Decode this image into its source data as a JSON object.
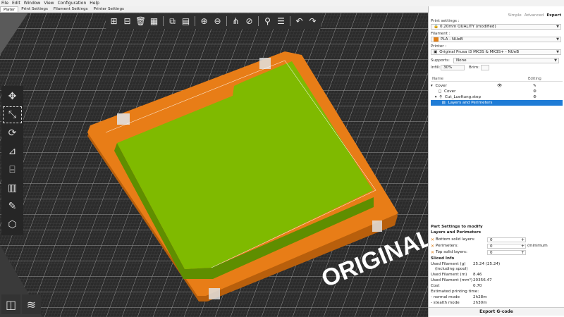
{
  "menu": [
    "File",
    "Edit",
    "Window",
    "View",
    "Configuration",
    "Help"
  ],
  "tabs": [
    {
      "label": "Plater",
      "active": true
    },
    {
      "label": "Print Settings",
      "active": false
    },
    {
      "label": "Filament Settings",
      "active": false
    },
    {
      "label": "Printer Settings",
      "active": false
    }
  ],
  "viewport": {
    "watermark": "ORIGINAL PR",
    "colors": {
      "bed": "#2b2b2b",
      "grid": "#9c9c9c",
      "base": "#e87d17",
      "top": "#7fba00",
      "topSide": "#5f8e00"
    }
  },
  "toolbar_icons": [
    "add-icon",
    "delete-icon",
    "delete-all-icon",
    "arrange-icon",
    "copy-icon",
    "paste-icon",
    "add-instance-icon",
    "remove-instance-icon",
    "split-objects-icon",
    "split-parts-icon",
    "search-icon",
    "layers-icon",
    "undo-icon",
    "redo-icon"
  ],
  "mode": {
    "simple": "Simple",
    "advanced": "Advanced",
    "expert": "Expert"
  },
  "print_settings": {
    "label": "Print settings :",
    "value": "0.20mm QUALITY (modified)"
  },
  "filament": {
    "label": "Filament :",
    "value": "PLA - NUeB",
    "color": "#e07f18"
  },
  "printer": {
    "label": "Printer :",
    "value": "Original Prusa i3 MK3S & MK3S+ - NUeB"
  },
  "supports": {
    "label": "Supports:",
    "value": "None"
  },
  "infill": {
    "label": "Infill:",
    "value": "30%"
  },
  "brim": {
    "label": "Brim:"
  },
  "object_list": {
    "col_name": "Name",
    "col_editing": "Editing",
    "rows": [
      {
        "label": "Cover",
        "indent": 0,
        "highlight": false
      },
      {
        "label": "Cover",
        "indent": 1,
        "highlight": false
      },
      {
        "label": "Cut_Lueftung.step",
        "indent": 1,
        "highlight": false
      },
      {
        "label": "Layers and Perimeters",
        "indent": 2,
        "highlight": true
      }
    ]
  },
  "part_settings": {
    "title": "Part Settings to modify",
    "group": "Layers and Perimeters",
    "params": [
      {
        "label": "Bottom solid layers:",
        "value": "0",
        "unit": ""
      },
      {
        "label": "Perimeters:",
        "value": "0",
        "unit": "(minimum"
      },
      {
        "label": "Top solid layers:",
        "value": "0",
        "unit": ""
      }
    ]
  },
  "sliced_info": {
    "title": "Sliced Info",
    "rows": [
      {
        "label": "Used Filament (g)",
        "value": "25.24 (25.24)"
      },
      {
        "label": "(including spool)",
        "value": ""
      },
      {
        "label": "Used Filament (m)",
        "value": "8.46"
      },
      {
        "label": "Used Filament (mm³)",
        "value": "20356.47"
      },
      {
        "label": "Cost",
        "value": "0.70"
      },
      {
        "label": "Estimated printing time:",
        "value": ""
      },
      {
        "label": "- normal mode",
        "value": "2h28m"
      },
      {
        "label": "- stealth mode",
        "value": "2h30m"
      }
    ]
  },
  "export_button": "Export G-code"
}
